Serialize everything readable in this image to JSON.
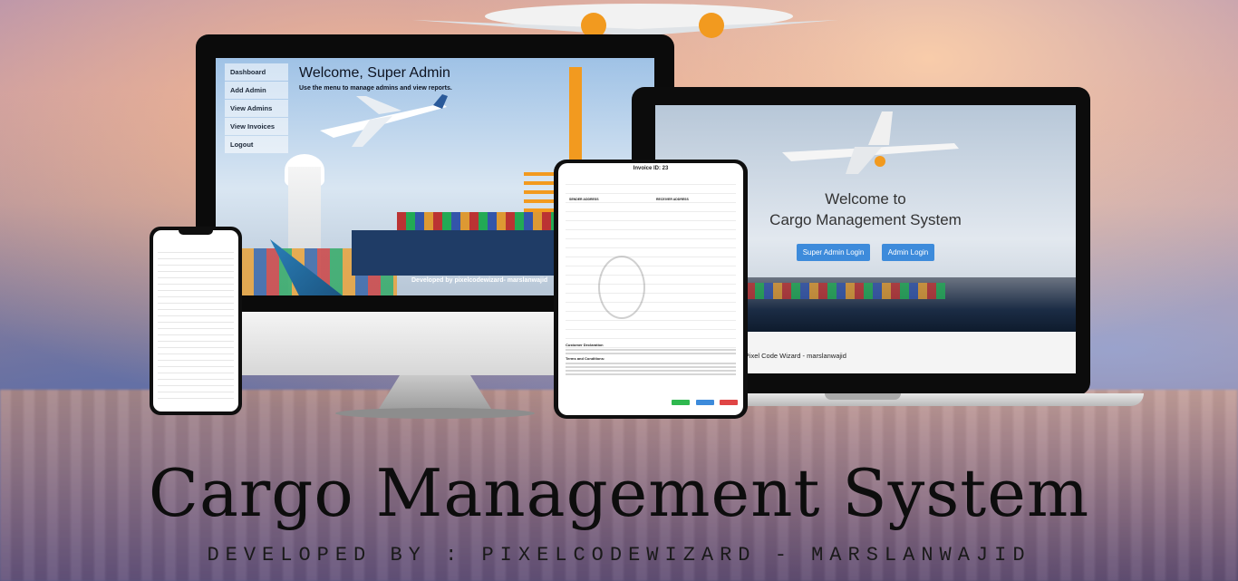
{
  "monitor": {
    "menu": [
      "Dashboard",
      "Add Admin",
      "View Admins",
      "View Invoices",
      "Logout"
    ],
    "title": "Welcome, Super Admin",
    "subtitle": "Use the menu to manage admins and view reports.",
    "footer": "Developed by pixelcodewizard- marslanwajid"
  },
  "laptop": {
    "title_line1": "Welcome to",
    "title_line2": "Cargo Management System",
    "buttons": [
      "Super Admin Login",
      "Admin Login"
    ],
    "footer": "Developed By Pixel Code Wizard - marslanwajid"
  },
  "tablet": {
    "invoice_title": "Invoice ID: 23",
    "sender_heading": "SENDER ADDRESS",
    "receiver_heading": "RECEIVER ADDRESS",
    "declaration_heading": "Customer Declaration",
    "terms_heading": "Terms and Conditions:"
  },
  "headline": "Cargo Management System",
  "subline": "DEVELOPED BY : PIXELCODEWIZARD - MARSLANWAJID",
  "colors": {
    "button_blue": "#3d8bdb",
    "btn_green": "#2fb84f",
    "btn_red": "#e04545"
  }
}
